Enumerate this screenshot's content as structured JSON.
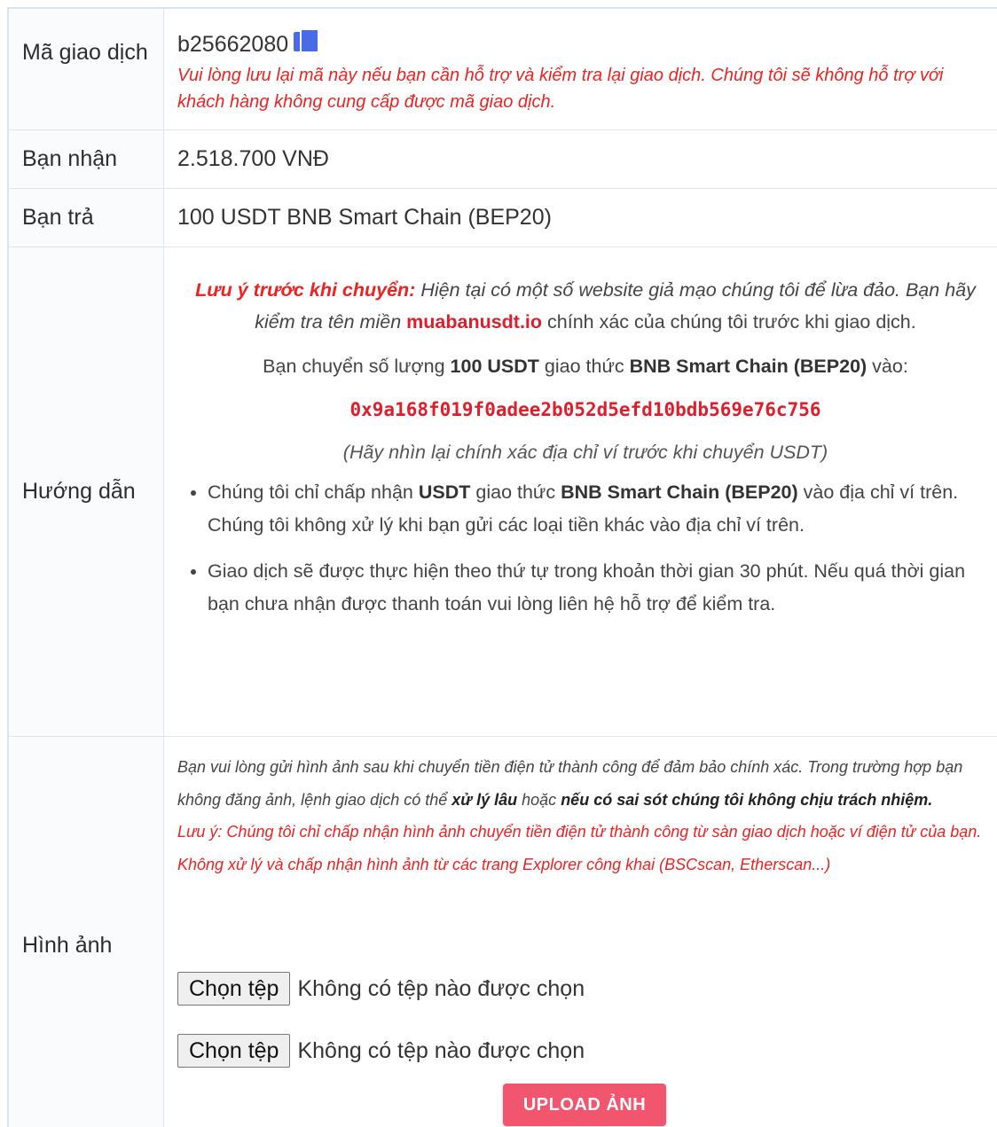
{
  "transaction": {
    "label": "Mã giao dịch",
    "code": "b25662080",
    "note": "Vui lòng lưu lại mã này nếu bạn cần hỗ trợ và kiểm tra lại giao dịch. Chúng tôi sẽ không hỗ trợ với khách hàng không cung cấp được mã giao dịch."
  },
  "receive": {
    "label": "Bạn nhận",
    "value": "2.518.700 VNĐ"
  },
  "pay": {
    "label": "Bạn trả",
    "value": "100 USDT BNB Smart Chain (BEP20)"
  },
  "guide": {
    "label": "Hướng dẫn",
    "warning_lead": "Lưu ý trước khi chuyển:",
    "warning_text_1": " Hiện tại có một số website giả mạo chúng tôi để lừa đảo. Bạn hãy kiểm tra tên miền ",
    "domain": "muabanusdt.io",
    "warning_text_2": " chính xác của chúng tôi trước khi giao dịch.",
    "transfer_prefix": "Bạn chuyển số lượng ",
    "amount": "100 USDT",
    "transfer_mid": " giao thức ",
    "network": "BNB Smart Chain (BEP20)",
    "transfer_suffix": " vào:",
    "address": "0x9a168f019f0adee2b052d5efd10bdb569e76c756",
    "hint": "(Hãy nhìn lại chính xác địa chỉ ví trước khi chuyển USDT)",
    "bullet1_prefix": "Chúng tôi chỉ chấp nhận ",
    "bullet1_coin": "USDT",
    "bullet1_mid": " giao thức ",
    "bullet1_network": "BNB Smart Chain (BEP20)",
    "bullet1_suffix": " vào địa chỉ ví trên. Chúng tôi không xử lý khi bạn gửi các loại tiền khác vào địa chỉ ví trên.",
    "bullet2": "Giao dịch sẽ được thực hiện theo thứ tự trong khoản thời gian 30 phút. Nếu quá thời gian bạn chưa nhận được thanh toán vui lòng liên hệ hỗ trợ để kiểm tra."
  },
  "image": {
    "label": "Hình ảnh",
    "note_1": "Bạn vui lòng gửi hình ảnh sau khi chuyển tiền điện tử thành công để đảm bảo chính xác. Trong trường hợp bạn không đăng ảnh, lệnh giao dịch có thể ",
    "note_bold_1": "xử lý lâu",
    "note_2": " hoặc ",
    "note_bold_2": "nếu có sai sót chúng tôi không chịu trách nhiệm.",
    "warning": "Lưu ý: Chúng tôi chỉ chấp nhận hình ảnh chuyển tiền điện tử thành công từ sàn giao dịch hoặc ví điện tử của bạn. Không xử lý và chấp nhận hình ảnh từ các trang Explorer công khai (BSCscan, Etherscan...)",
    "file_button_label": "Chọn tệp",
    "no_file_text": "Không có tệp nào được chọn",
    "upload_label": "UPLOAD ẢNH"
  },
  "colors": {
    "accent_red": "#ee2222",
    "upload_button": "#f2556e",
    "copy_icon": "#4a6be8"
  }
}
